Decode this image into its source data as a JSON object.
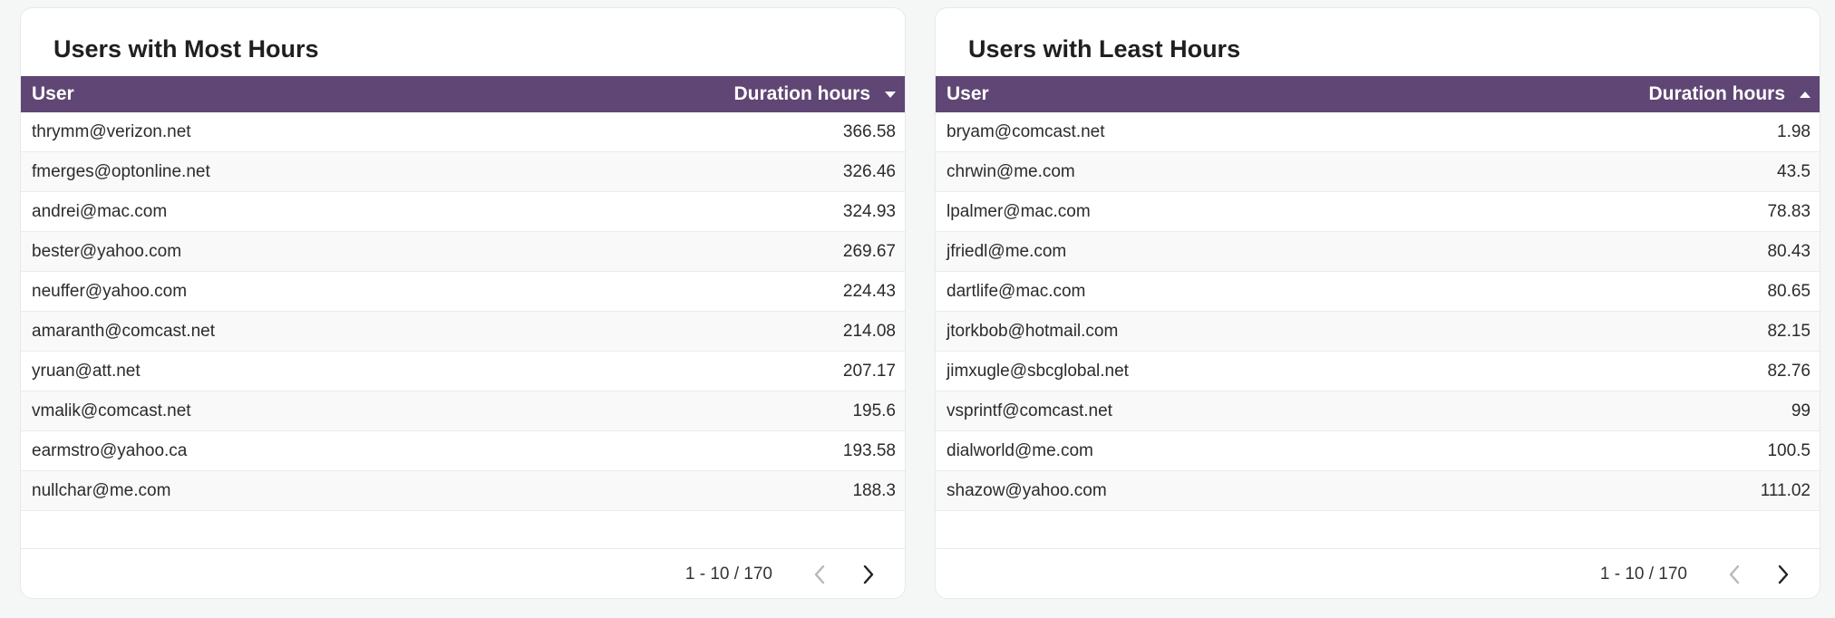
{
  "most": {
    "title": "Users with Most Hours",
    "col_user": "User",
    "col_duration": "Duration hours",
    "rows": [
      {
        "user": "thrymm@verizon.net",
        "hours": "366.58"
      },
      {
        "user": "fmerges@optonline.net",
        "hours": "326.46"
      },
      {
        "user": "andrei@mac.com",
        "hours": "324.93"
      },
      {
        "user": "bester@yahoo.com",
        "hours": "269.67"
      },
      {
        "user": "neuffer@yahoo.com",
        "hours": "224.43"
      },
      {
        "user": "amaranth@comcast.net",
        "hours": "214.08"
      },
      {
        "user": "yruan@att.net",
        "hours": "207.17"
      },
      {
        "user": "vmalik@comcast.net",
        "hours": "195.6"
      },
      {
        "user": "earmstro@yahoo.ca",
        "hours": "193.58"
      },
      {
        "user": "nullchar@me.com",
        "hours": "188.3"
      }
    ],
    "pagination": "1 - 10 / 170",
    "sort": "descending"
  },
  "least": {
    "title": "Users with Least Hours",
    "col_user": "User",
    "col_duration": "Duration hours",
    "rows": [
      {
        "user": "bryam@comcast.net",
        "hours": "1.98"
      },
      {
        "user": "chrwin@me.com",
        "hours": "43.5"
      },
      {
        "user": "lpalmer@mac.com",
        "hours": "78.83"
      },
      {
        "user": "jfriedl@me.com",
        "hours": "80.43"
      },
      {
        "user": "dartlife@mac.com",
        "hours": "80.65"
      },
      {
        "user": "jtorkbob@hotmail.com",
        "hours": "82.15"
      },
      {
        "user": "jimxugle@sbcglobal.net",
        "hours": "82.76"
      },
      {
        "user": "vsprintf@comcast.net",
        "hours": "99"
      },
      {
        "user": "dialworld@me.com",
        "hours": "100.5"
      },
      {
        "user": "shazow@yahoo.com",
        "hours": "111.02"
      }
    ],
    "pagination": "1 - 10 / 170",
    "sort": "ascending"
  },
  "colors": {
    "header_bg": "#604674",
    "page_bg": "#f5f7f7",
    "card_bg": "#ffffff"
  },
  "icons": {
    "prev": "chevron-left-icon",
    "next": "chevron-right-icon",
    "sort_desc": "sort-down-icon",
    "sort_asc": "sort-up-icon"
  }
}
